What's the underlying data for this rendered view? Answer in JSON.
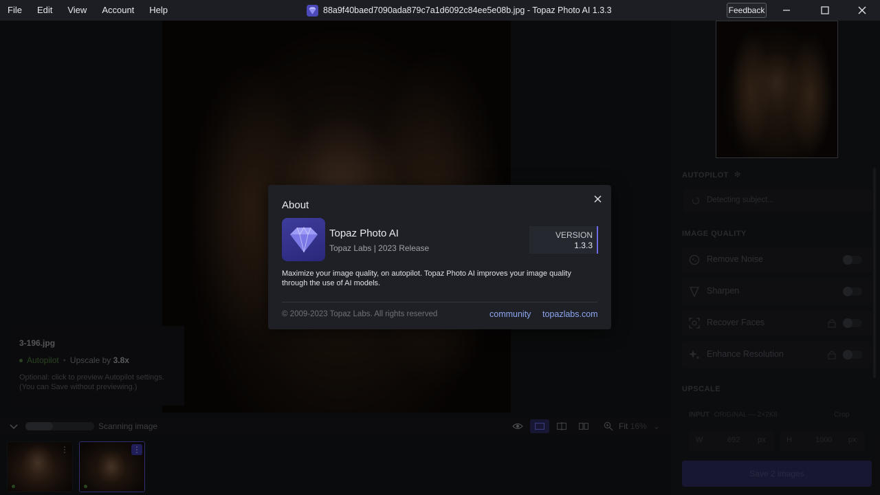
{
  "menu": [
    "File",
    "Edit",
    "View",
    "Account",
    "Help"
  ],
  "window": {
    "title": "88a9f40baed7090ada879c7a1d6092c84ee5e08b.jpg - Topaz Photo AI 1.3.3",
    "feedback_label": "Feedback"
  },
  "canvas": {
    "file_name": "3-196.jpg",
    "autopilot_label": "Autopilot",
    "upscale_prefix": "Upscale by ",
    "upscale_value": "3.8x",
    "optional_line1": "Optional: click to preview Autopilot settings.",
    "optional_line2": "(You can Save without previewing.)"
  },
  "bottombar": {
    "scan_label": "Scanning image",
    "scan_progress": 0.4,
    "zoom_label": "Fit",
    "zoom_pct": "16%"
  },
  "right_panel": {
    "autopilot_heading": "AUTOPILOT",
    "detecting": "Detecting subject...",
    "image_quality_heading": "IMAGE QUALITY",
    "filters": [
      "Remove Noise",
      "Sharpen",
      "Recover Faces",
      "Enhance Resolution"
    ],
    "upscale_heading": "UPSCALE",
    "input_label": "INPUT",
    "original_label": "ORIGINAL — 2×2K8",
    "crop_label": "Crop",
    "width_prefix": "W",
    "width_value": "692",
    "width_unit": "px",
    "height_prefix": "H",
    "height_value": "1000",
    "height_unit": "px",
    "save_label": "Save 2 images"
  },
  "about": {
    "title": "About",
    "app_name": "Topaz Photo AI",
    "app_sub": "Topaz Labs | 2023 Release",
    "version_label": "VERSION",
    "version_num": "1.3.3",
    "description": "Maximize your image quality, on autopilot. Topaz Photo AI improves your image quality through the use of AI models.",
    "copyright": "© 2009-2023 Topaz Labs. All rights reserved",
    "link_community": "community",
    "link_site": "topazlabs.com"
  },
  "colors": {
    "accent": "#6d6ae8",
    "link": "#8da6f0",
    "autopilot_green": "#4d7a3c"
  },
  "icons": [
    "topaz-logo-icon",
    "minimize-icon",
    "maximize-icon",
    "close-icon",
    "gear-icon",
    "eye-icon",
    "single-view-icon",
    "split-view-icon",
    "side-by-side-icon",
    "zoom-icon",
    "chevron-down-icon",
    "kebab-icon",
    "lock-icon"
  ]
}
